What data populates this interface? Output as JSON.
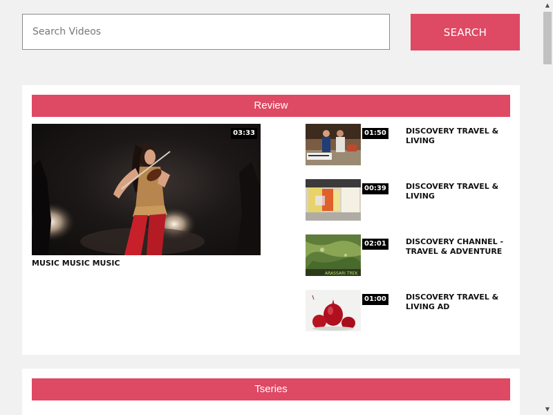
{
  "search": {
    "placeholder": "Search Videos",
    "button_label": "SEARCH"
  },
  "sections": [
    {
      "title": "Review",
      "featured": {
        "title": "MUSIC MUSIC MUSIC",
        "duration": "03:33"
      },
      "items": [
        {
          "title": "DISCOVERY TRAVEL & LIVING",
          "duration": "01:50"
        },
        {
          "title": "DISCOVERY TRAVEL & LIVING",
          "duration": "00:39"
        },
        {
          "title": "DISCOVERY CHANNEL - TRAVEL & ADVENTURE",
          "duration": "02:01",
          "thumb_caption": "ARASSARI TREK"
        },
        {
          "title": "DISCOVERY TRAVEL & LIVING AD",
          "duration": "01:00"
        }
      ]
    },
    {
      "title": "Tseries"
    }
  ],
  "colors": {
    "accent": "#de4964",
    "background": "#f1f1f1"
  }
}
